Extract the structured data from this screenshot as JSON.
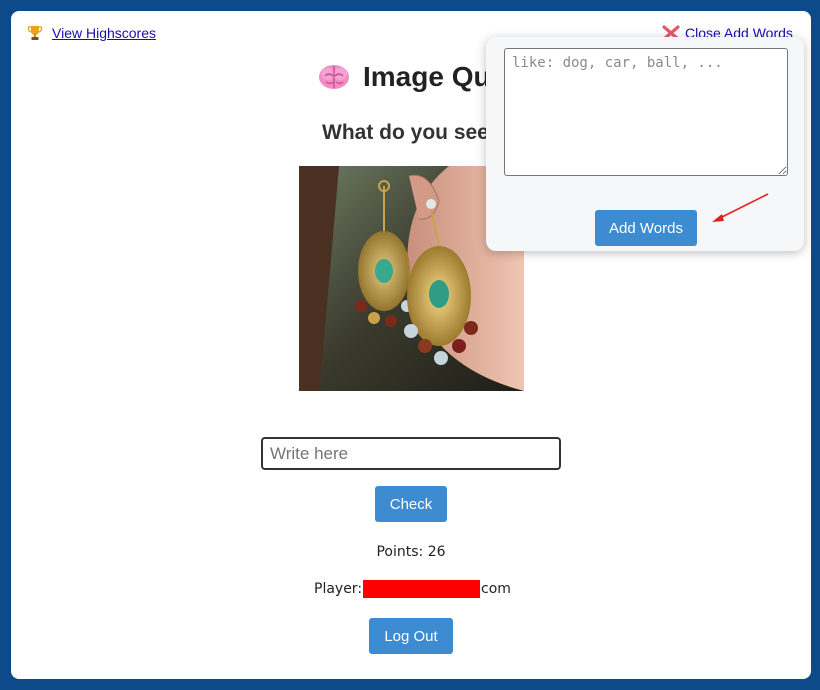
{
  "header": {
    "highscores_link": "View Highscores",
    "close_add_words_link": "Close Add Words"
  },
  "quiz": {
    "title": "Image Qu",
    "question": "What do you see",
    "image_alt": "earrings"
  },
  "answer": {
    "placeholder": "Write here",
    "check_label": "Check"
  },
  "stats": {
    "points_label": "Points:",
    "points_value": "26",
    "player_label": "Player:",
    "player_suffix": "com"
  },
  "logout_label": "Log Out",
  "add_words": {
    "placeholder": "like: dog, car, ball, ...",
    "button_label": "Add Words"
  },
  "icons": {
    "highscores": "trophy-icon",
    "close": "x-icon",
    "title": "brain-icon"
  },
  "colors": {
    "background": "#0d4a8a",
    "button": "#3d8bd1",
    "link": "#1a0dab",
    "annotation_arrow": "#e02020",
    "redaction": "#ff0000"
  }
}
